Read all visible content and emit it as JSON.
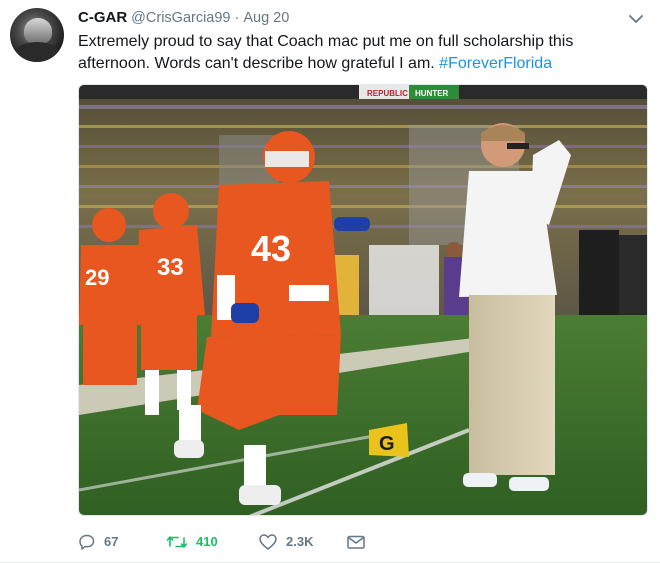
{
  "tweet": {
    "display_name": "C-GAR",
    "handle": "@CrisGarcia99",
    "separator": "·",
    "timestamp": "Aug 20",
    "text": "Extremely proud to say that Coach mac put me on full scholarship this afternoon. Words can't describe how grateful I am.",
    "hashtag": "#ForeverFlorida",
    "photo": {
      "scoreboard_banner": "REPUBLIC",
      "scoreboard_banner_sub": "HUNTER",
      "field_marker": "G",
      "jersey_numbers": [
        "43",
        "33",
        "29"
      ]
    }
  },
  "actions": {
    "reply_count": "67",
    "retweet_count": "410",
    "like_count": "2.3K"
  },
  "colors": {
    "text": "#14171a",
    "secondary": "#657786",
    "hashtag": "#1b95e0",
    "retweet_active": "#17bf63",
    "jersey_orange": "#e8571f",
    "jersey_blue": "#1f3fa8"
  },
  "icons": [
    "caret-down-icon",
    "reply-icon",
    "retweet-icon",
    "heart-icon",
    "envelope-icon"
  ]
}
